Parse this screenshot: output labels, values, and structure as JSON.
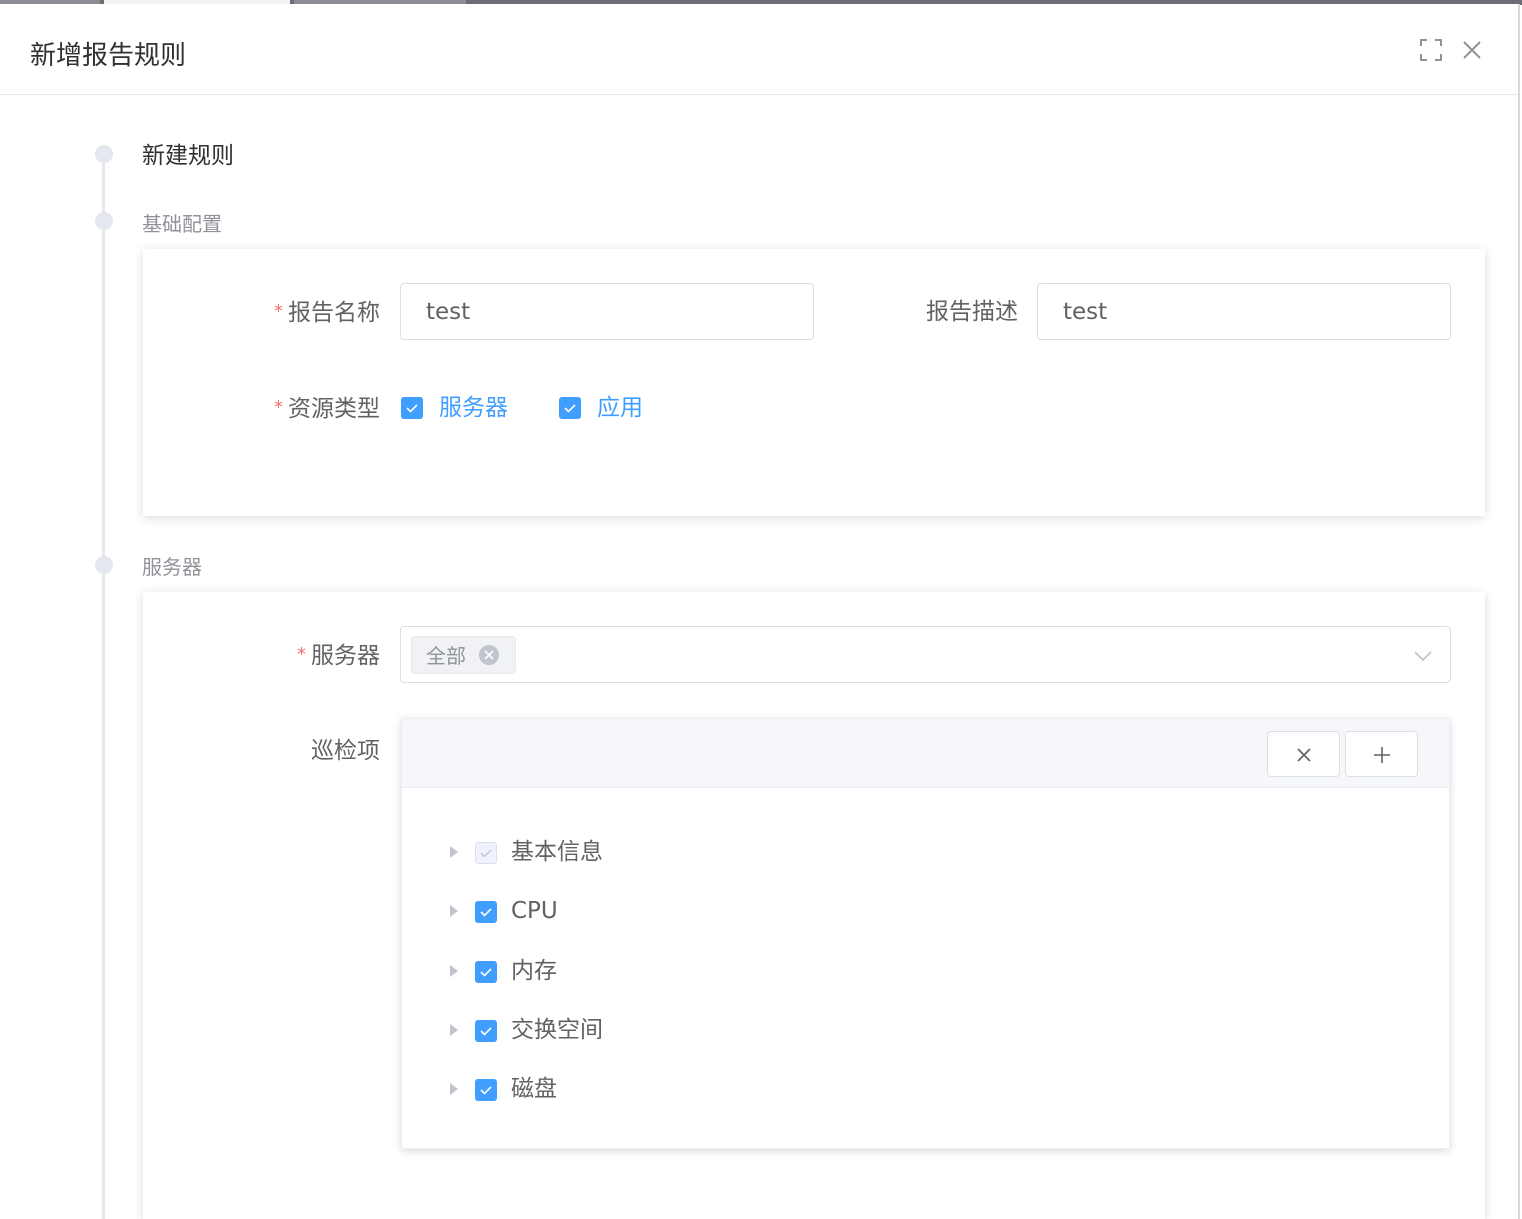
{
  "dialog": {
    "title": "新增报告规则",
    "fullscreen_icon": "fullscreen-icon",
    "close_icon": "close-icon"
  },
  "timeline": {
    "step1": "新建规则",
    "step2": "基础配置",
    "step3": "服务器"
  },
  "basic": {
    "name_label": "报告名称",
    "name_value": "test",
    "desc_label": "报告描述",
    "desc_value": "test",
    "type_label": "资源类型",
    "types": [
      {
        "label": "服务器",
        "checked": true
      },
      {
        "label": "应用",
        "checked": true
      }
    ]
  },
  "server": {
    "server_label": "服务器",
    "selected_tag": "全部",
    "inspect_label": "巡检项",
    "toolbar": {
      "collapse_icon": "close-icon",
      "expand_icon": "plus-icon"
    },
    "tree": [
      {
        "label": "基本信息",
        "checked": true,
        "disabled": true
      },
      {
        "label": "CPU",
        "checked": true,
        "disabled": false
      },
      {
        "label": "内存",
        "checked": true,
        "disabled": false
      },
      {
        "label": "交换空间",
        "checked": true,
        "disabled": false
      },
      {
        "label": "磁盘",
        "checked": true,
        "disabled": false
      }
    ]
  },
  "colors": {
    "primary": "#409eff",
    "required": "#f56c6c",
    "text": "#606266",
    "muted": "#909399"
  }
}
